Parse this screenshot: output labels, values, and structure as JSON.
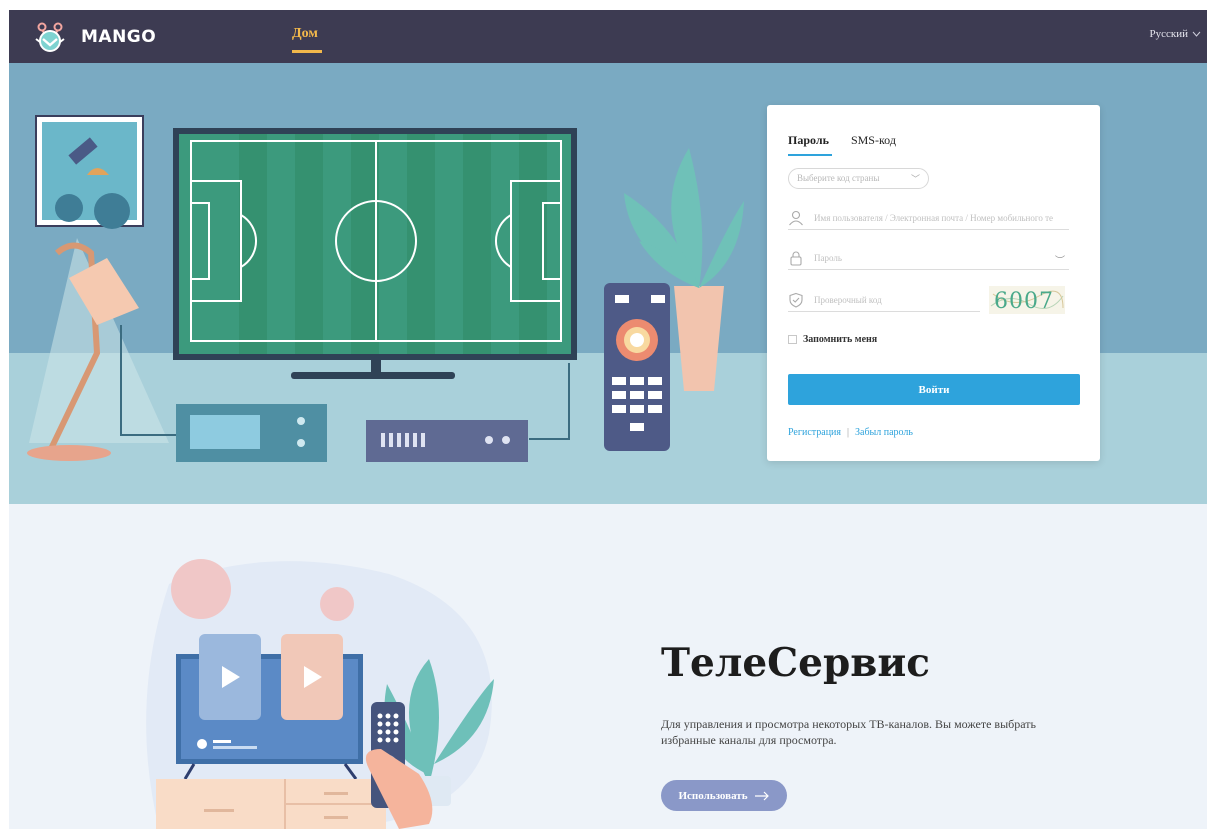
{
  "header": {
    "brand": "MANGO",
    "nav_home": "Дом",
    "language": "Русский"
  },
  "login": {
    "tabs": [
      "Пароль",
      "SMS-код"
    ],
    "active_tab": "Пароль",
    "country_placeholder": "Выберите код страны",
    "username_placeholder": "Имя пользователя / Электронная почта / Номер мобильного те",
    "password_placeholder": "Пароль",
    "captcha_placeholder": "Проверочный код",
    "captcha_value": "6007",
    "remember_label": "Запомнить меня",
    "login_button": "Войти",
    "register_link": "Регистрация",
    "separator": "|",
    "forgot_link": "Забыл пароль"
  },
  "promo": {
    "title": "ТелеСервис",
    "description": "Для управления и просмотра некоторых ТВ-каналов. Вы можете выбрать избранные каналы для просмотра.",
    "use_button": "Использовать"
  },
  "colors": {
    "header_bg": "#3d3b52",
    "accent": "#f2b84b",
    "primary": "#2ea3dc",
    "hero_bg": "#7aaac2",
    "hero_floor": "#a9d0da",
    "use_button": "#8a98c8"
  },
  "icons": {
    "logo": "mango-logo-icon",
    "language_dropdown": "chevron-down-icon",
    "user": "user-icon",
    "lock": "lock-icon",
    "shield": "shield-icon",
    "eye": "eye-closed-icon",
    "arrow": "arrow-right-icon"
  }
}
